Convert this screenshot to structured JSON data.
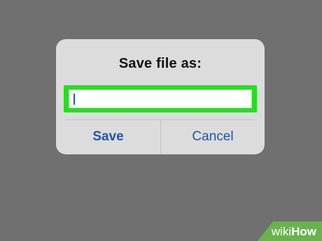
{
  "dialog": {
    "title": "Save file as:",
    "input": {
      "value": "",
      "highlight_color": "#22E11B"
    },
    "buttons": {
      "save_label": "Save",
      "cancel_label": "Cancel"
    }
  },
  "watermark": {
    "brand_part1": "wiki",
    "brand_part2": "How",
    "color": "#69B24E"
  }
}
